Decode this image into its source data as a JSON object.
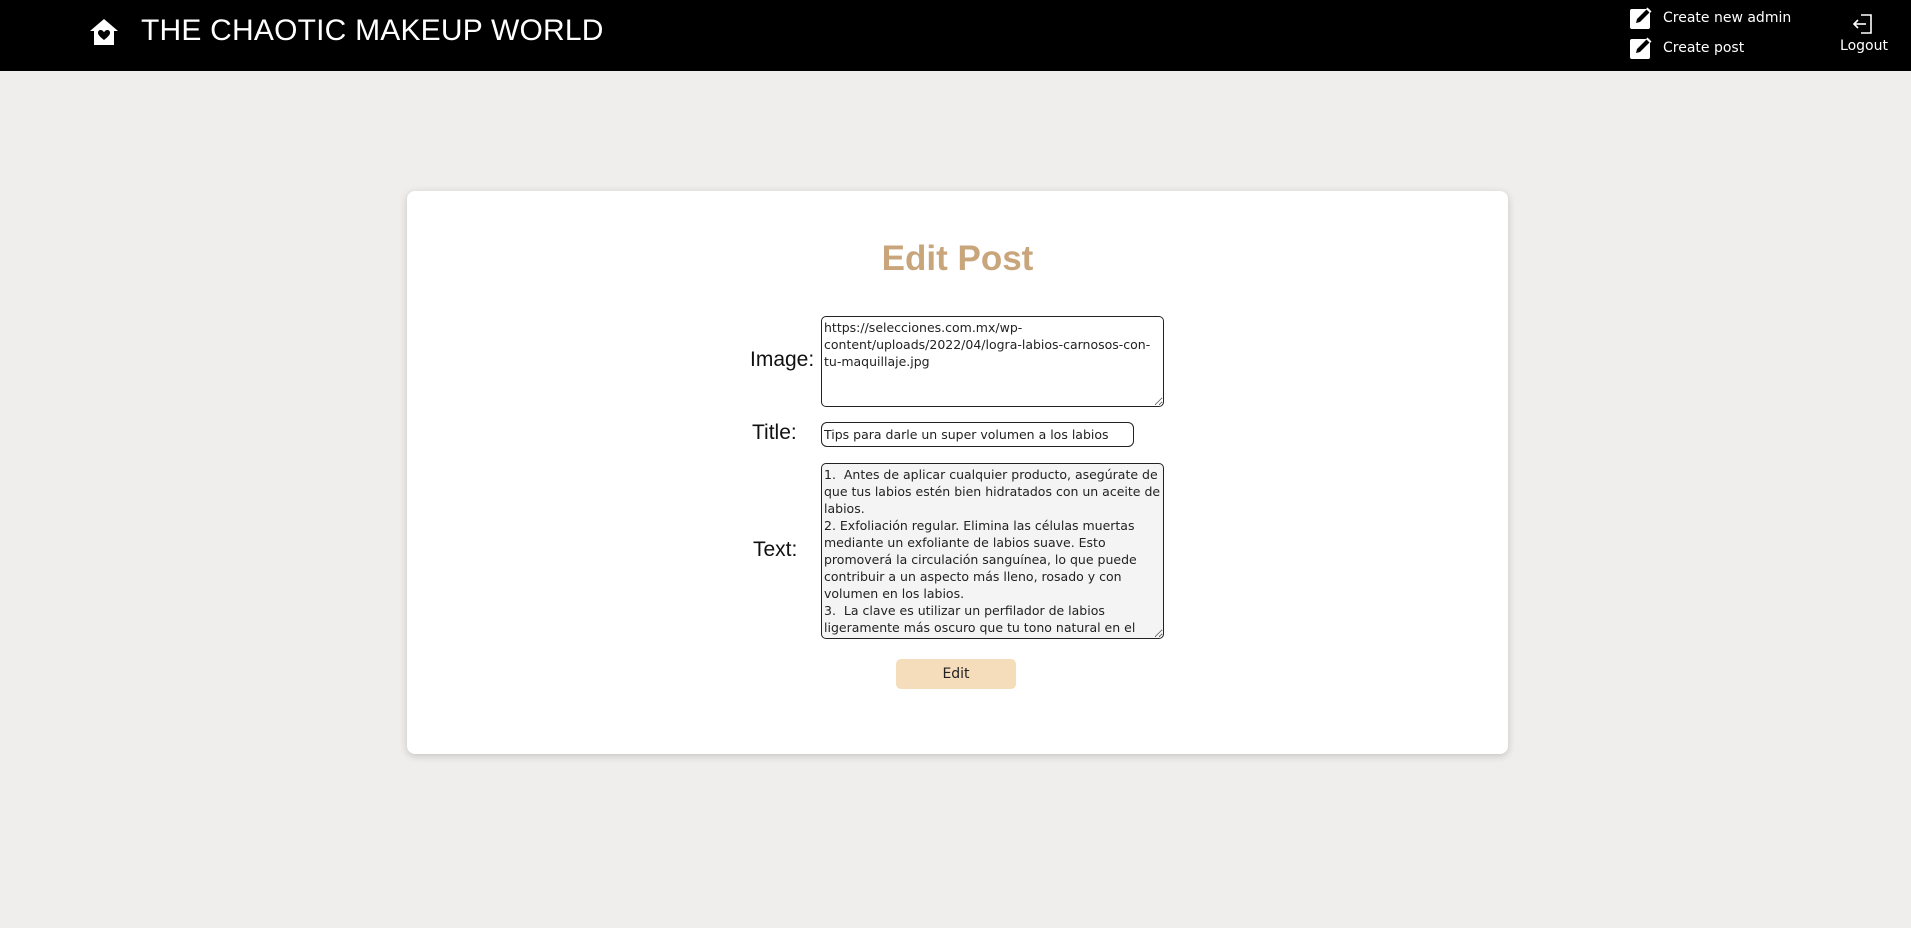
{
  "header": {
    "brand": "THE CHAOTIC MAKEUP WORLD",
    "home_icon": "home-heart-icon",
    "create_admin_label": "Create new admin",
    "create_post_label": "Create post",
    "edit_icon": "edit-square-icon",
    "logout_label": "Logout",
    "logout_icon": "logout-icon"
  },
  "form": {
    "title": "Edit Post",
    "image_label": "Image:",
    "image_value": "https://selecciones.com.mx/wp-content/uploads/2022/04/logra-labios-carnosos-con-tu-maquillaje.jpg",
    "title_label": "Title:",
    "title_value": "Tips para darle un super volumen a los labios",
    "text_label": "Text:",
    "text_value": "1.  Antes de aplicar cualquier producto, asegúrate de que tus labios estén bien hidratados con un aceite de labios.\n2. Exfoliación regular. Elimina las células muertas mediante un exfoliante de labios suave. Esto promoverá la circulación sanguínea, lo que puede contribuir a un aspecto más lleno, rosado y con volumen en los labios.\n3.  La clave es utilizar un perfilador de labios ligeramente más oscuro que tu tono natural en el",
    "submit_label": "Edit"
  },
  "colors": {
    "header_bg": "#000000",
    "page_bg": "#efeeec",
    "title_color": "#c9a57c",
    "button_bg": "#f5dcbb"
  }
}
